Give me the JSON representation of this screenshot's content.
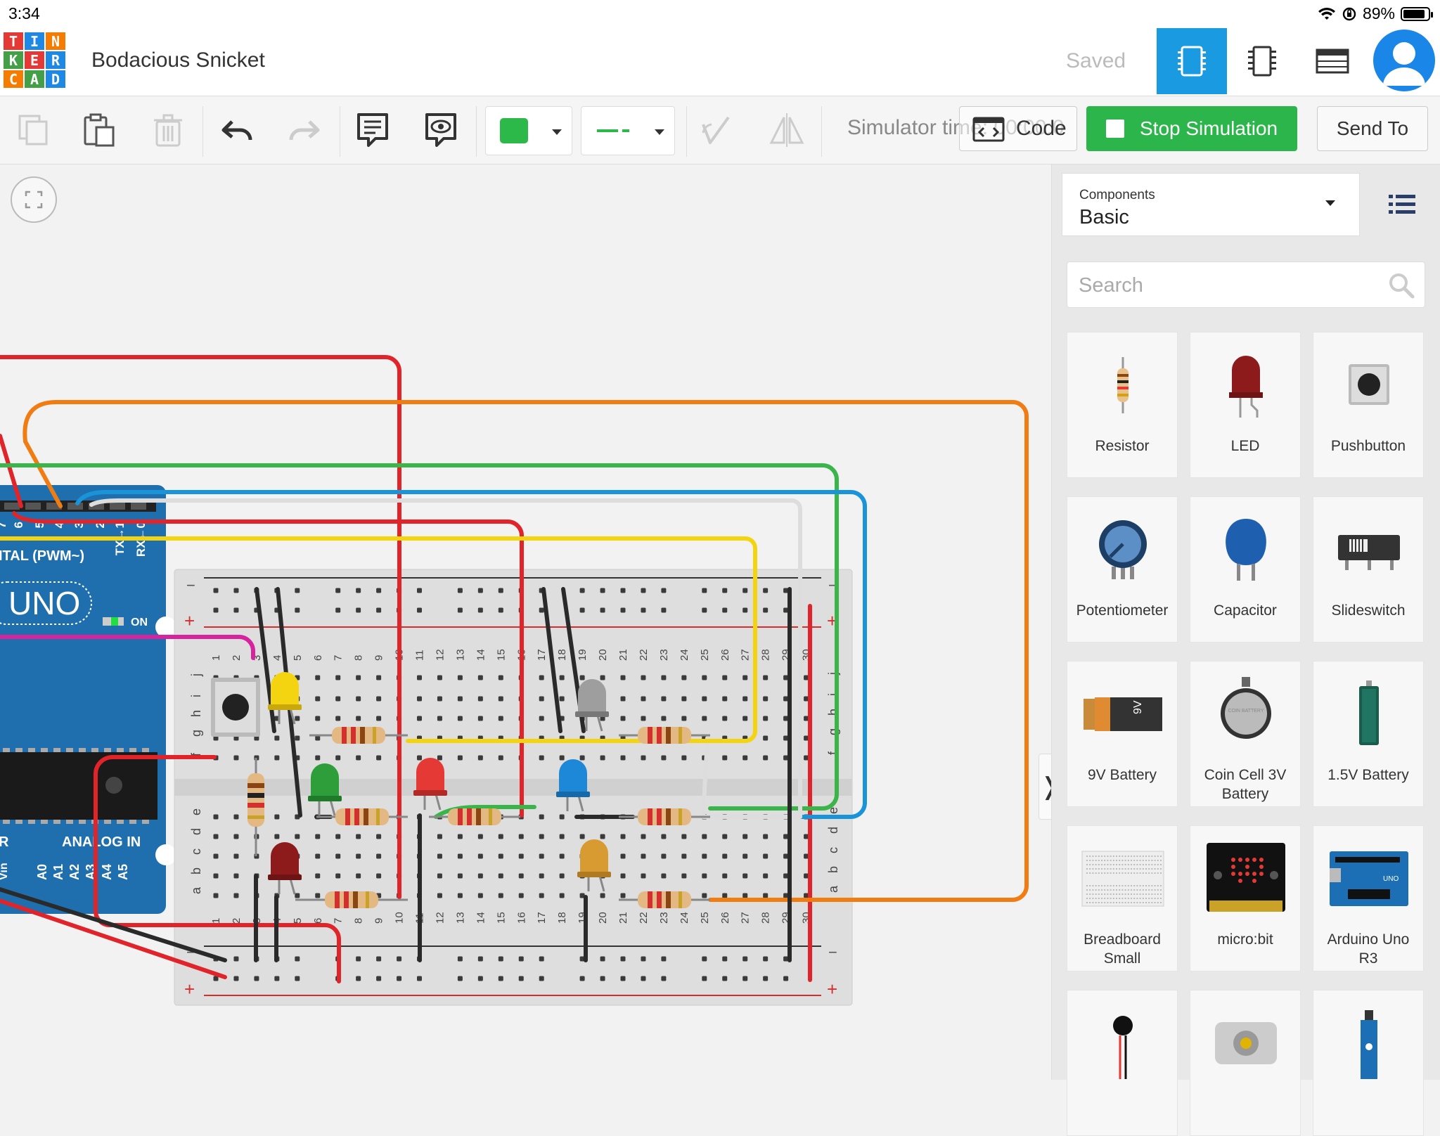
{
  "status_bar": {
    "time": "3:34",
    "battery": "89%",
    "battery_level": 0.89
  },
  "header": {
    "logo_letters": [
      "T",
      "I",
      "N",
      "K",
      "E",
      "R",
      "C",
      "A",
      "D"
    ],
    "logo_colors": [
      "#e53935",
      "#1e88e5",
      "#f57c00",
      "#43a047",
      "#e53935",
      "#1e88e5",
      "#f57c00",
      "#43a047",
      "#1e88e5"
    ],
    "project_title": "Bodacious Snicket",
    "save_status": "Saved"
  },
  "toolbar": {
    "fill_color": "#2db84a",
    "simulator_time_label": "Simulator time: 00:00:0",
    "code_label": "Code",
    "stop_simulation_label": "Stop Simulation",
    "send_to_label": "Send To"
  },
  "panel": {
    "components_label": "Components",
    "components_value": "Basic",
    "search_placeholder": "Search",
    "items": [
      {
        "label": "Resistor"
      },
      {
        "label": "LED"
      },
      {
        "label": "Pushbutton"
      },
      {
        "label": "Potentiometer"
      },
      {
        "label": "Capacitor"
      },
      {
        "label": "Slideswitch"
      },
      {
        "label": "9V Battery"
      },
      {
        "label": "Coin Cell 3V Battery"
      },
      {
        "label": "1.5V Battery"
      },
      {
        "label": "Breadboard Small"
      },
      {
        "label": "micro:bit"
      },
      {
        "label": "Arduino Uno R3"
      },
      {
        "label": ""
      },
      {
        "label": ""
      },
      {
        "label": ""
      }
    ]
  },
  "canvas": {
    "arduino": {
      "digital_label": "ITAL (PWM~)",
      "pin_labels": [
        "7",
        "6",
        "5",
        "4",
        "3",
        "2",
        "TX→1",
        "RX←0"
      ],
      "board_label": "UNO",
      "on_label": "ON",
      "analog_label": "ANALOG IN",
      "analog_pins": [
        "A0",
        "A1",
        "A2",
        "A3",
        "A4",
        "A5"
      ],
      "vin_label": "Vin",
      "r_label": "R"
    },
    "breadboard": {
      "column_numbers": [
        "1",
        "2",
        "3",
        "4",
        "5",
        "6",
        "7",
        "8",
        "9",
        "10",
        "11",
        "12",
        "13",
        "14",
        "15",
        "16",
        "17",
        "18",
        "19",
        "20",
        "21",
        "22",
        "23",
        "24",
        "25",
        "26",
        "27",
        "28",
        "29",
        "30"
      ],
      "top_rows": [
        "j",
        "i",
        "h",
        "g",
        "f"
      ],
      "bottom_rows": [
        "e",
        "d",
        "c",
        "b",
        "a"
      ],
      "minus": "−",
      "plus": "+"
    },
    "wire_colors": {
      "red": "#e0242a",
      "orange": "#f07c12",
      "green": "#3ab54a",
      "blue": "#1a94d8",
      "yellow": "#f4d411",
      "white": "#ffffff",
      "black": "#2a2a2a",
      "magenta": "#d6249f"
    }
  }
}
